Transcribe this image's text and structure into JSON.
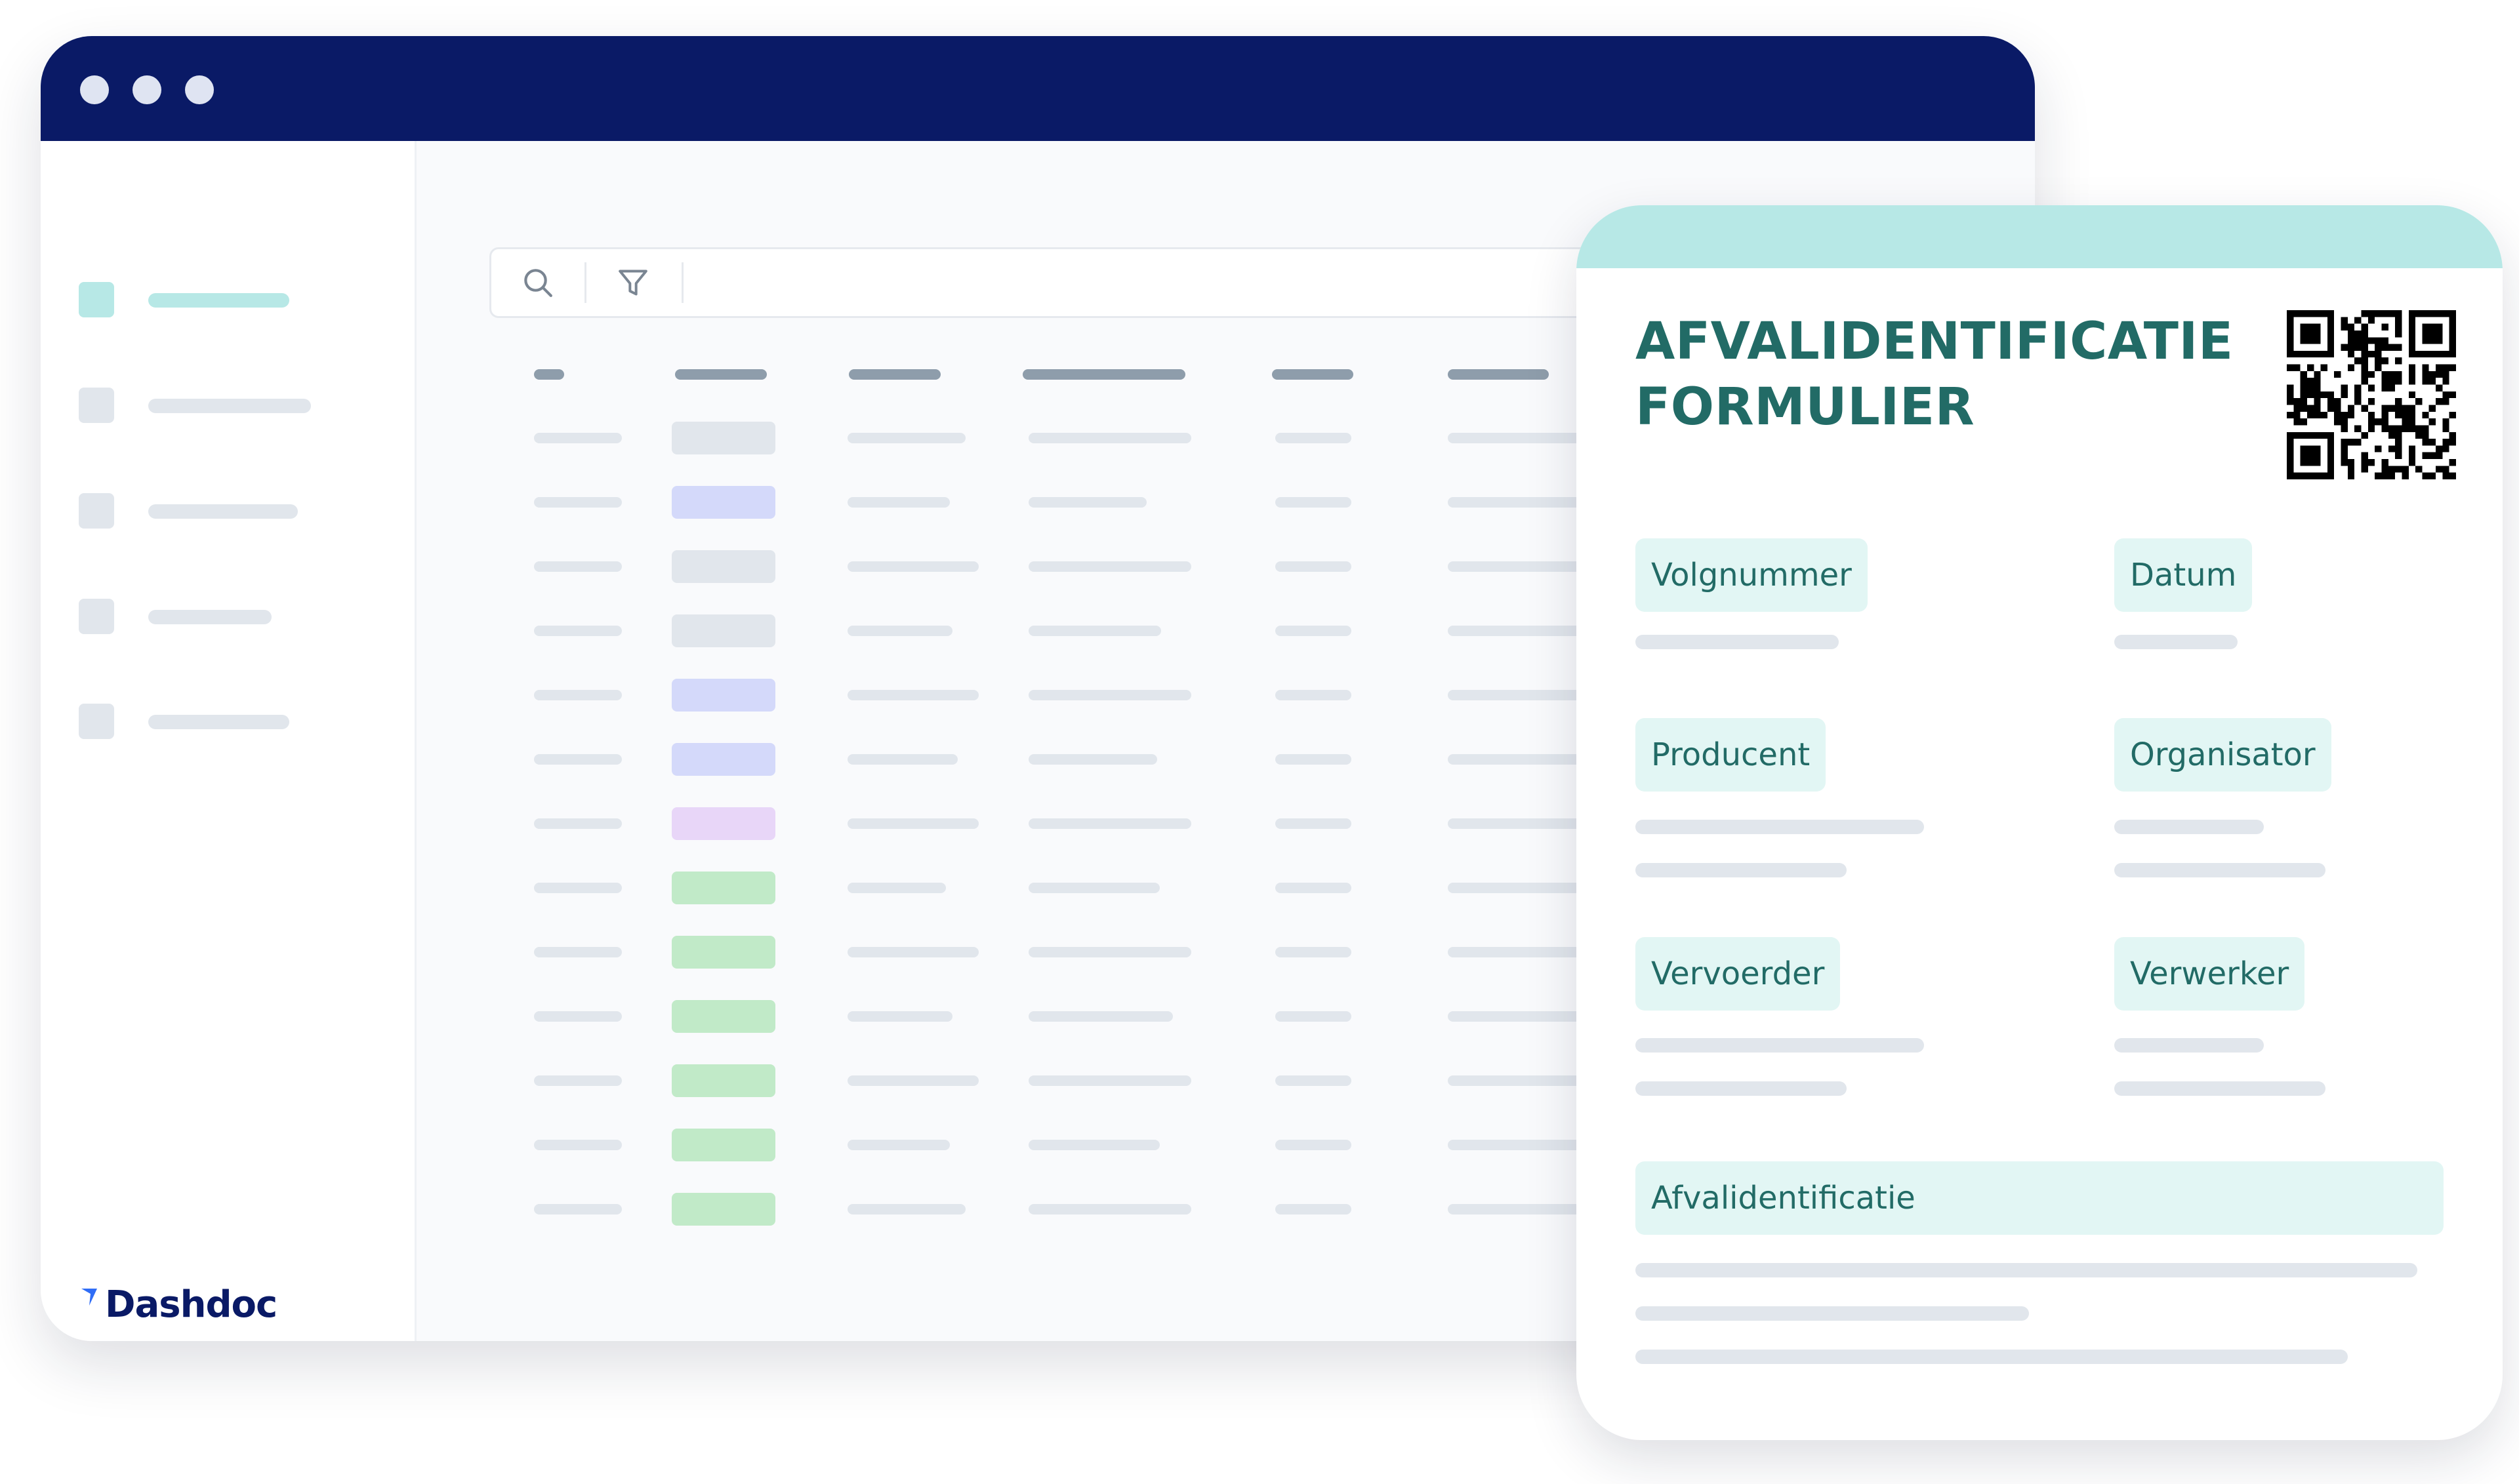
{
  "brand": {
    "name": "Dashdoc"
  },
  "icons": {
    "search": "search-icon",
    "filter": "filter-icon",
    "qr": "qr-code-icon",
    "logo": "dashdoc-logo-icon"
  },
  "colors": {
    "titlebar": "#0a1a66",
    "accent": "#b7e8e6",
    "form_text": "#226b66",
    "form_label_bg": "#e2f6f4",
    "status_gray": "#e1e6ec",
    "status_blue": "#d4d9fa",
    "status_purple": "#e8d6f8",
    "status_green": "#c1eac8"
  },
  "form": {
    "title": "AFVALIDENTIFICATIEFORMULIER",
    "fields": {
      "sequence_number": "Volgnummer",
      "date": "Datum",
      "producer": "Producent",
      "organizer": "Organisator",
      "carrier": "Vervoerder",
      "processor": "Verwerker",
      "waste_identification": "Afvalidentificatie"
    }
  },
  "table": {
    "row_statuses": [
      "gray",
      "blue",
      "gray",
      "gray",
      "blue",
      "blue",
      "purple",
      "green",
      "green",
      "green",
      "green",
      "green",
      "green"
    ]
  }
}
